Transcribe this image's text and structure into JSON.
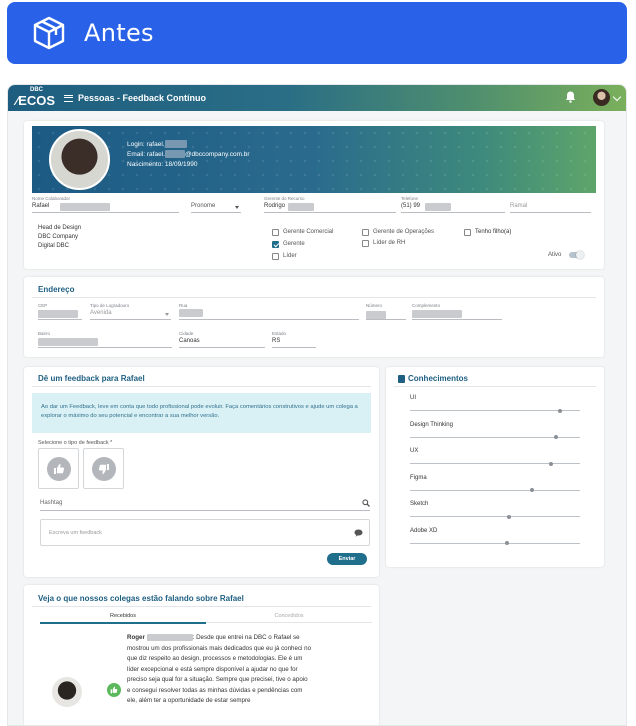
{
  "banner": {
    "title": "Antes",
    "icon": "package-box-icon",
    "color": "#2962e8"
  },
  "app": {
    "logo_top": "DBC",
    "logo_main": "ECOS",
    "breadcrumb": "Pessoas - Feedback Contínuo"
  },
  "profile": {
    "login": "Login: rafael.",
    "email_prefix": "Email: rafael.",
    "email_suffix": "@dbccompany.com.br",
    "birth": "Nascimento: 18/09/1990",
    "fields": {
      "name_label": "Nome Colaborador",
      "name_value": "Rafael",
      "pronoun_placeholder": "Pronome",
      "manager_label": "Gerente do Recurso",
      "manager_value": "Rodrigo",
      "phone_label": "Telefone",
      "phone_value": "(51) 99",
      "extension_placeholder": "Ramal"
    },
    "role_lines": [
      "Head de Design",
      "DBC Company",
      "Digital DBC"
    ],
    "checkboxes": [
      {
        "label": "Gerente Comercial",
        "checked": false
      },
      {
        "label": "Gerente",
        "checked": true
      },
      {
        "label": "Líder",
        "checked": false
      },
      {
        "label": "Gerente de Operações",
        "checked": false
      },
      {
        "label": "Líder de RH",
        "checked": false
      },
      {
        "label": "Tenho filho(a)",
        "checked": false
      }
    ],
    "active_label": "Ativo"
  },
  "address": {
    "title": "Endereço",
    "cep_label": "CEP",
    "street_type_label": "Tipo de Logradouro",
    "street_type_value": "Avenida",
    "street_label": "Rua",
    "number_label": "Número",
    "complement_label": "Complemento",
    "district_label": "Bairro",
    "city_label": "Cidade",
    "city_value": "Canoas",
    "state_label": "Estado",
    "state_value": "RS"
  },
  "feedback": {
    "title": "Dê um feedback para Rafael",
    "info": "Ao dar um Feedback, leve em conta que todo profissional pode evoluir. Faça comentários construtivos e ajude um colega a explorar o máximo do seu potencial e encontrar a sua melhor versão.",
    "type_label": "Selecione o tipo de feedback *",
    "hashtag_placeholder": "Hashtag",
    "message_placeholder": "Escreva um feedback",
    "send_label": "Enviar"
  },
  "knowledge": {
    "title": "Conhecimentos",
    "skills": [
      {
        "name": "UI",
        "level": 0.88
      },
      {
        "name": "Design Thinking",
        "level": 0.86
      },
      {
        "name": "UX",
        "level": 0.83
      },
      {
        "name": "Figma",
        "level": 0.72
      },
      {
        "name": "Sketch",
        "level": 0.58
      },
      {
        "name": "Adobe XD",
        "level": 0.57
      }
    ]
  },
  "colleagues": {
    "title": "Veja o que nossos colegas estão falando sobre Rafael",
    "tabs": [
      "Recebidos",
      "Concedidos"
    ],
    "review_author": "Roger",
    "review_text": ": Desde que entrei na DBC o Rafael se mostrou um dos profissionais mais dedicados que eu já conheci no que diz respeito ao design, processos e metodologias. Ele é um líder excepcional e está sempre disponível a ajudar no que for preciso seja qual for a situação. Sempre que precisei, tive o apoio e consegui resolver todas as minhas dúvidas e pendências com ele, além ter a oportunidade de estar sempre"
  },
  "colors": {
    "accent": "#1f6e8c",
    "info_bg": "#d9f1f4",
    "like": "#5cb85c"
  }
}
